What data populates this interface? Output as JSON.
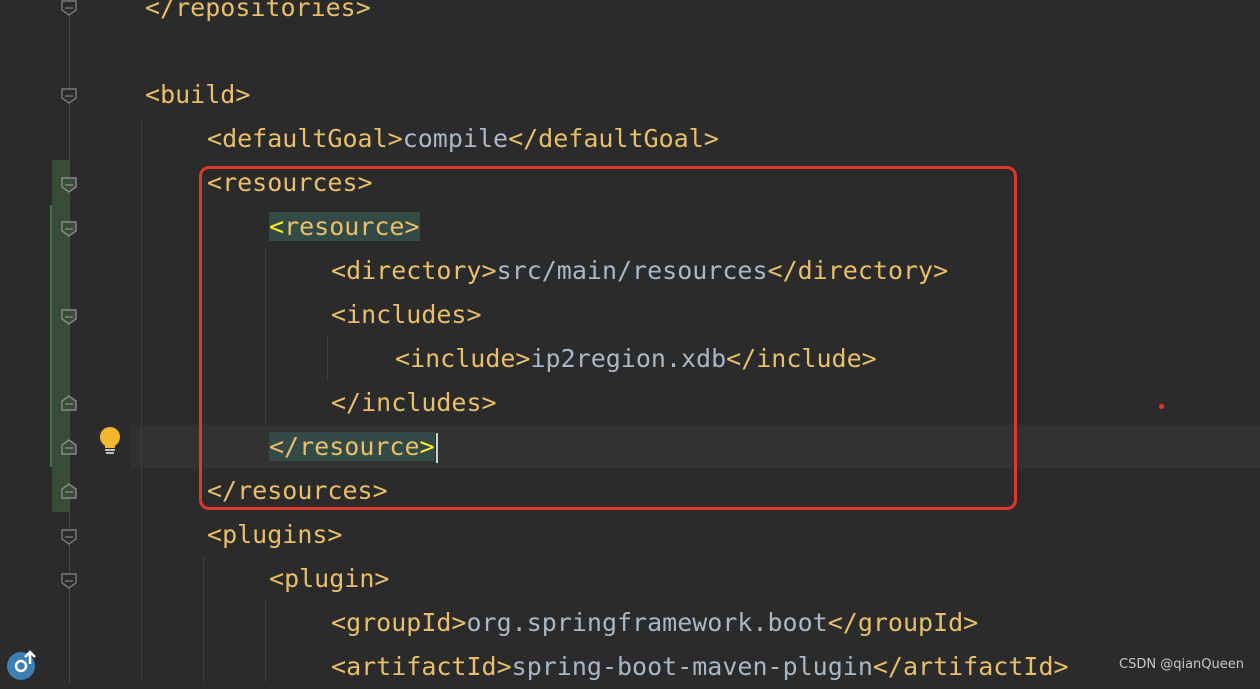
{
  "editor": {
    "lines": [
      {
        "open": "</",
        "name": "repositories",
        "close": ">",
        "text": ""
      },
      {
        "open": "<",
        "name": "build",
        "close": ">",
        "text": ""
      },
      {
        "open": "<",
        "name": "defaultGoal",
        "close": ">",
        "text": "compile",
        "end": "</defaultGoal>"
      },
      {
        "open": "<",
        "name": "resources",
        "close": ">",
        "text": ""
      },
      {
        "open": "<",
        "name": "resource",
        "close": ">",
        "text": ""
      },
      {
        "open": "<",
        "name": "directory",
        "close": ">",
        "text": "src/main/resources",
        "end": "</directory>"
      },
      {
        "open": "<",
        "name": "includes",
        "close": ">",
        "text": ""
      },
      {
        "open": "<",
        "name": "include",
        "close": ">",
        "text": "ip2region.xdb",
        "end": "</include>"
      },
      {
        "open": "</",
        "name": "includes",
        "close": ">",
        "text": ""
      },
      {
        "open": "</",
        "name": "resource",
        "close": ">",
        "text": ""
      },
      {
        "open": "</",
        "name": "resources",
        "close": ">",
        "text": ""
      },
      {
        "open": "<",
        "name": "plugins",
        "close": ">",
        "text": ""
      },
      {
        "open": "<",
        "name": "plugin",
        "close": ">",
        "text": ""
      },
      {
        "open": "<",
        "name": "groupId",
        "close": ">",
        "text": "org.springframework.boot",
        "end": "</groupId>"
      },
      {
        "open": "<",
        "name": "artifactId",
        "close": ">",
        "text": "spring-boot-maven-plugin",
        "end": "</artifactId>"
      }
    ]
  },
  "colors": {
    "background": "#2b2b2b",
    "tag": "#e8bf6a",
    "text": "#a9b7c6",
    "highlight_box": "#e0372c",
    "brace_match": "#344a46"
  },
  "icons": [
    "fold-marker-icon",
    "intention-bulb-icon",
    "update-icon"
  ],
  "watermark": "CSDN @qianQueen"
}
